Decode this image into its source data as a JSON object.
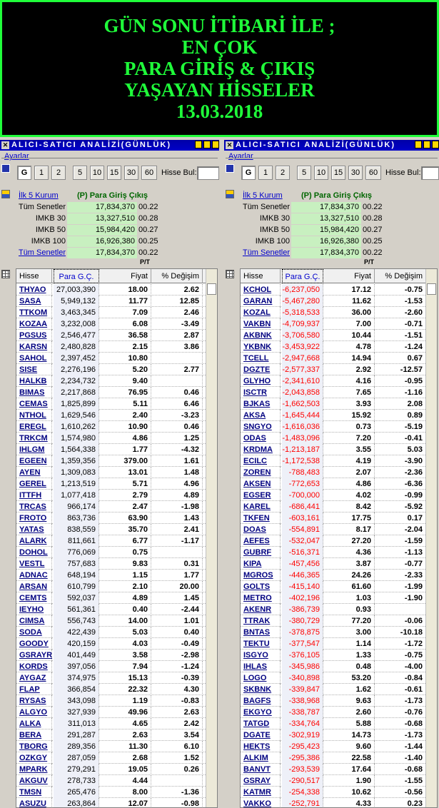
{
  "banner": {
    "lines": [
      "GÜN SONU İTİBARİ İLE ;",
      "EN ÇOK",
      "PARA GİRİŞ & ÇIKIŞ",
      "YAŞAYAN HİSSELER",
      "13.03.2018"
    ]
  },
  "panels": [
    {
      "title": "ALICI-SATICI ANALİZİ(GÜNLÜK)",
      "settings_label": "Ayarlar",
      "period_buttons": [
        "G",
        "1",
        "2",
        "5",
        "10",
        "15",
        "30",
        "60"
      ],
      "stock_search_label": "Hisse Bul:",
      "summary": {
        "first5_link": "İlk 5 Kurum",
        "header": "(P) Para Giriş Çıkış",
        "rows": [
          {
            "label": "Tüm Senetler",
            "value": "17,834,370",
            "pct": "00.22",
            "link": false
          },
          {
            "label": "IMKB 30",
            "value": "13,327,510",
            "pct": "00.28",
            "link": false
          },
          {
            "label": "IMKB 50",
            "value": "15,984,420",
            "pct": "00.27",
            "link": false
          },
          {
            "label": "IMKB 100",
            "value": "16,926,380",
            "pct": "00.25",
            "link": false
          },
          {
            "label": "Tüm Senetler",
            "value": "17,834,370",
            "pct": "00.22",
            "link": true
          }
        ],
        "pt_label": "P/T"
      },
      "columns": [
        "Hisse",
        "Para G.Ç.",
        "Fiyat",
        "% Değişim"
      ],
      "rows": [
        [
          "THYAO",
          "27,003,390",
          "18.00",
          "2.62"
        ],
        [
          "SASA",
          "5,949,132",
          "11.77",
          "12.85"
        ],
        [
          "TTKOM",
          "3,463,345",
          "7.09",
          "2.46"
        ],
        [
          "KOZAA",
          "3,232,008",
          "6.08",
          "-3.49"
        ],
        [
          "PGSUS",
          "2,546,477",
          "36.58",
          "2.87"
        ],
        [
          "KARSN",
          "2,480,828",
          "2.15",
          "3.86"
        ],
        [
          "SAHOL",
          "2,397,452",
          "10.80",
          ""
        ],
        [
          "SISE",
          "2,276,196",
          "5.20",
          "2.77"
        ],
        [
          "HALKB",
          "2,234,732",
          "9.40",
          ""
        ],
        [
          "BIMAS",
          "2,217,868",
          "76.95",
          "0.46"
        ],
        [
          "CEMAS",
          "1,825,899",
          "5.11",
          "6.46"
        ],
        [
          "NTHOL",
          "1,629,546",
          "2.40",
          "-3.23"
        ],
        [
          "EREGL",
          "1,610,262",
          "10.90",
          "0.46"
        ],
        [
          "TRKCM",
          "1,574,980",
          "4.86",
          "1.25"
        ],
        [
          "IHLGM",
          "1,564,338",
          "1.77",
          "-4.32"
        ],
        [
          "EGEEN",
          "1,359,356",
          "379.00",
          "1.61"
        ],
        [
          "AYEN",
          "1,309,083",
          "13.01",
          "1.48"
        ],
        [
          "GEREL",
          "1,213,519",
          "5.71",
          "4.96"
        ],
        [
          "ITTFH",
          "1,077,418",
          "2.79",
          "4.89"
        ],
        [
          "TRCAS",
          "966,174",
          "2.47",
          "-1.98"
        ],
        [
          "FROTO",
          "863,736",
          "63.90",
          "1.43"
        ],
        [
          "YATAS",
          "838,559",
          "35.70",
          "2.41"
        ],
        [
          "ALARK",
          "811,661",
          "6.77",
          "-1.17"
        ],
        [
          "DOHOL",
          "776,069",
          "0.75",
          ""
        ],
        [
          "VESTL",
          "757,683",
          "9.83",
          "0.31"
        ],
        [
          "ADNAC",
          "648,194",
          "1.15",
          "1.77"
        ],
        [
          "ARSAN",
          "610,799",
          "2.10",
          "20.00"
        ],
        [
          "CEMTS",
          "592,037",
          "4.89",
          "1.45"
        ],
        [
          "IEYHO",
          "561,361",
          "0.40",
          "-2.44"
        ],
        [
          "CIMSA",
          "556,743",
          "14.00",
          "1.01"
        ],
        [
          "SODA",
          "422,439",
          "5.03",
          "0.40"
        ],
        [
          "GOODY",
          "420,159",
          "4.03",
          "-0.49"
        ],
        [
          "GSRAYR",
          "401,449",
          "3.58",
          "-2.98"
        ],
        [
          "KORDS",
          "397,056",
          "7.94",
          "-1.24"
        ],
        [
          "AYGAZ",
          "374,975",
          "15.13",
          "-0.39"
        ],
        [
          "FLAP",
          "366,854",
          "22.32",
          "4.30"
        ],
        [
          "RYSAS",
          "343,098",
          "1.19",
          "-0.83"
        ],
        [
          "ALGYO",
          "327,939",
          "49.96",
          "2.63"
        ],
        [
          "ALKA",
          "311,013",
          "4.65",
          "2.42"
        ],
        [
          "BERA",
          "291,287",
          "2.63",
          "3.54"
        ],
        [
          "TBORG",
          "289,356",
          "11.30",
          "6.10"
        ],
        [
          "OZKGY",
          "287,059",
          "2.68",
          "1.52"
        ],
        [
          "MPARK",
          "279,291",
          "19.05",
          "0.26"
        ],
        [
          "AKGUV",
          "278,733",
          "4.44",
          ""
        ],
        [
          "TMSN",
          "265,476",
          "8.00",
          "-1.36"
        ],
        [
          "ASUZU",
          "263,864",
          "12.07",
          "-0.98"
        ]
      ]
    },
    {
      "title": "ALICI-SATICI ANALİZİ(GÜNLÜK)",
      "settings_label": "Ayarlar",
      "period_buttons": [
        "G",
        "1",
        "2",
        "5",
        "10",
        "15",
        "30",
        "60"
      ],
      "stock_search_label": "Hisse Bul:",
      "summary": {
        "first5_link": "İlk 5 Kurum",
        "header": "(P) Para Giriş Çıkış",
        "rows": [
          {
            "label": "Tüm Senetler",
            "value": "17,834,370",
            "pct": "00.22",
            "link": false
          },
          {
            "label": "IMKB 30",
            "value": "13,327,510",
            "pct": "00.28",
            "link": false
          },
          {
            "label": "IMKB 50",
            "value": "15,984,420",
            "pct": "00.27",
            "link": false
          },
          {
            "label": "IMKB 100",
            "value": "16,926,380",
            "pct": "00.25",
            "link": false
          },
          {
            "label": "Tüm Senetler",
            "value": "17,834,370",
            "pct": "00.22",
            "link": true
          }
        ],
        "pt_label": "P/T"
      },
      "columns": [
        "Hisse",
        "Para G.Ç.",
        "Fiyat",
        "% Değişim"
      ],
      "rows": [
        [
          "KCHOL",
          "-6,237,050",
          "17.12",
          "-0.75"
        ],
        [
          "GARAN",
          "-5,467,280",
          "11.62",
          "-1.53"
        ],
        [
          "KOZAL",
          "-5,318,533",
          "36.00",
          "-2.60"
        ],
        [
          "VAKBN",
          "-4,709,937",
          "7.00",
          "-0.71"
        ],
        [
          "AKBNK",
          "-3,706,580",
          "10.44",
          "-1.51"
        ],
        [
          "YKBNK",
          "-3,453,922",
          "4.78",
          "-1.24"
        ],
        [
          "TCELL",
          "-2,947,668",
          "14.94",
          "0.67"
        ],
        [
          "DGZTE",
          "-2,577,337",
          "2.92",
          "-12.57"
        ],
        [
          "GLYHO",
          "-2,341,610",
          "4.16",
          "-0.95"
        ],
        [
          "ISCTR",
          "-2,043,858",
          "7.65",
          "-1.16"
        ],
        [
          "BJKAS",
          "-1,662,503",
          "3.93",
          "2.08"
        ],
        [
          "AKSA",
          "-1,645,444",
          "15.92",
          "0.89"
        ],
        [
          "SNGYO",
          "-1,616,036",
          "0.73",
          "-5.19"
        ],
        [
          "ODAS",
          "-1,483,096",
          "7.20",
          "-0.41"
        ],
        [
          "KRDMA",
          "-1,213,187",
          "3.55",
          "5.03"
        ],
        [
          "ECILC",
          "-1,172,538",
          "4.19",
          "-3.90"
        ],
        [
          "ZOREN",
          "-788,483",
          "2.07",
          "-2.36"
        ],
        [
          "AKSEN",
          "-772,653",
          "4.86",
          "-6.36"
        ],
        [
          "EGSER",
          "-700,000",
          "4.02",
          "-0.99"
        ],
        [
          "KAREL",
          "-686,441",
          "8.42",
          "-5.92"
        ],
        [
          "TKFEN",
          "-603,161",
          "17.75",
          "0.17"
        ],
        [
          "DOAS",
          "-554,891",
          "8.17",
          "-2.04"
        ],
        [
          "AEFES",
          "-532,047",
          "27.20",
          "-1.59"
        ],
        [
          "GUBRF",
          "-516,371",
          "4.36",
          "-1.13"
        ],
        [
          "KIPA",
          "-457,456",
          "3.87",
          "-0.77"
        ],
        [
          "MGROS",
          "-446,365",
          "24.26",
          "-2.33"
        ],
        [
          "GOLTS",
          "-415,140",
          "61.60",
          "-1.99"
        ],
        [
          "METRO",
          "-402,196",
          "1.03",
          "-1.90"
        ],
        [
          "AKENR",
          "-386,739",
          "0.93",
          ""
        ],
        [
          "TTRAK",
          "-380,729",
          "77.20",
          "-0.06"
        ],
        [
          "BNTAS",
          "-378,875",
          "3.00",
          "-10.18"
        ],
        [
          "TEKTU",
          "-377,547",
          "1.14",
          "-1.72"
        ],
        [
          "ISGYO",
          "-376,105",
          "1.33",
          "-0.75"
        ],
        [
          "IHLAS",
          "-345,986",
          "0.48",
          "-4.00"
        ],
        [
          "LOGO",
          "-340,898",
          "53.20",
          "-0.84"
        ],
        [
          "SKBNK",
          "-339,847",
          "1.62",
          "-0.61"
        ],
        [
          "BAGFS",
          "-338,968",
          "9.63",
          "-1.73"
        ],
        [
          "EKGYO",
          "-338,787",
          "2.60",
          "-0.76"
        ],
        [
          "TATGD",
          "-334,764",
          "5.88",
          "-0.68"
        ],
        [
          "DGATE",
          "-302,919",
          "14.73",
          "-1.73"
        ],
        [
          "HEKTS",
          "-295,423",
          "9.60",
          "-1.44"
        ],
        [
          "ALKIM",
          "-295,386",
          "22.58",
          "-1.40"
        ],
        [
          "BANVT",
          "-293,539",
          "17.64",
          "-0.68"
        ],
        [
          "GSRAY",
          "-290,517",
          "1.90",
          "-1.55"
        ],
        [
          "KATMR",
          "-254,338",
          "10.62",
          "-0.56"
        ],
        [
          "VAKKO",
          "-252,791",
          "4.33",
          "0.23"
        ]
      ]
    }
  ]
}
